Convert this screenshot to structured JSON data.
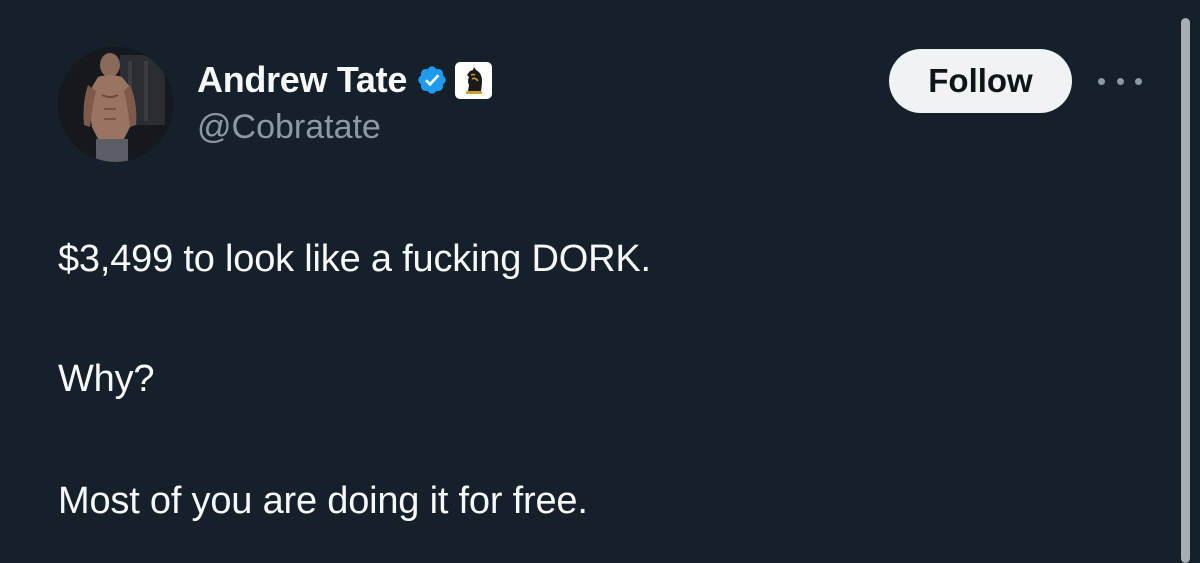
{
  "tweet": {
    "author": {
      "display_name": "Andrew Tate",
      "handle": "@Cobratate",
      "verified_icon": "verified-badge-icon",
      "affiliate_icon": "chess-knight-icon",
      "avatar_icon": "profile-photo"
    },
    "follow_label": "Follow",
    "more_icon": "more-options-icon",
    "text_lines": [
      "$3,499 to look like a fucking DORK.",
      "Why?",
      "Most of you are doing it for free."
    ]
  },
  "colors": {
    "background": "#15202b",
    "text_primary": "#f7f9f9",
    "text_secondary": "#8b98a5",
    "verified_blue": "#1d9bf0",
    "follow_bg": "#eff3f4",
    "follow_text": "#0f1419"
  }
}
